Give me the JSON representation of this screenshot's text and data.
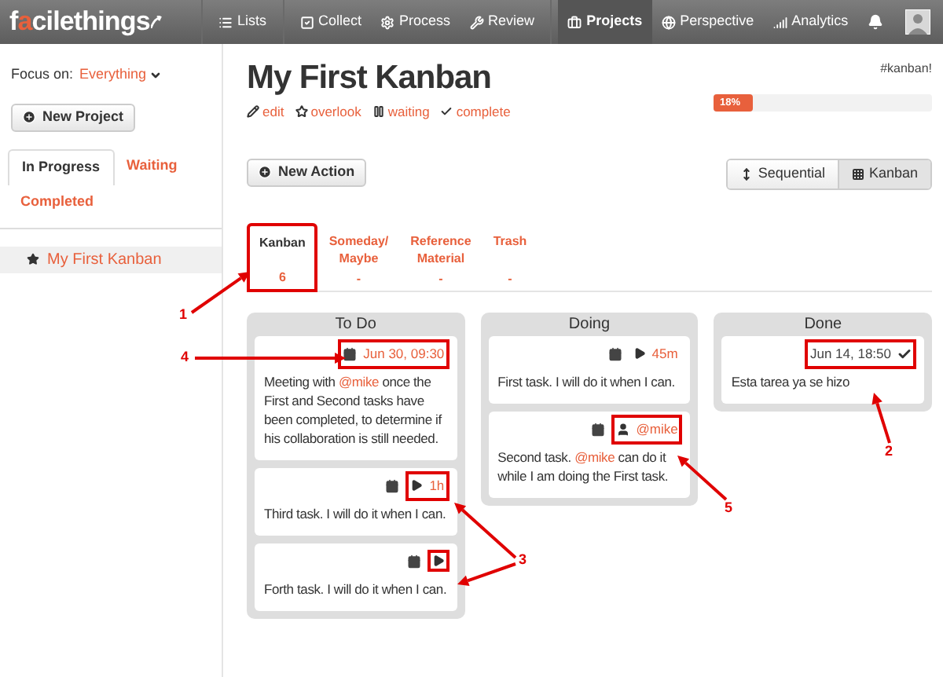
{
  "logo": {
    "parts": [
      {
        "text": "f",
        "accent": false
      },
      {
        "text": "a",
        "accent": true
      },
      {
        "text": "cilethings",
        "accent": false
      }
    ]
  },
  "nav": [
    [
      {
        "label": "Lists",
        "selected": false
      }
    ],
    [
      {
        "label": "Collect",
        "selected": false
      },
      {
        "label": "Process",
        "selected": false
      },
      {
        "label": "Review",
        "selected": false
      }
    ],
    [
      {
        "label": "Projects",
        "selected": true
      },
      {
        "label": "Perspective",
        "selected": false
      },
      {
        "label": "Analytics",
        "selected": false
      }
    ]
  ],
  "sidebar": {
    "focus_label": "Focus on:",
    "focus_value": "Everything",
    "new_project": "New Project",
    "tabs": [
      {
        "label": "In Progress",
        "selected": true
      },
      {
        "label": "Waiting",
        "selected": false
      },
      {
        "label": "Completed",
        "selected": false
      }
    ],
    "projects": [
      {
        "name": "My First Kanban",
        "selected": true
      }
    ]
  },
  "project": {
    "title": "My First Kanban",
    "tag": "#kanban!",
    "links": [
      {
        "kind": "edit",
        "label": "edit"
      },
      {
        "kind": "overlook",
        "label": "overlook"
      },
      {
        "kind": "waiting",
        "label": "waiting"
      },
      {
        "kind": "complete",
        "label": "complete"
      }
    ],
    "progress": {
      "level": 0.18,
      "reading": "18%"
    }
  },
  "new_action": "New Action",
  "views": [
    {
      "kind": "sequential",
      "label": "Sequential",
      "selected": false
    },
    {
      "kind": "kanban",
      "label": "Kanban",
      "selected": true
    }
  ],
  "list_tabs": [
    {
      "label": "Kanban",
      "count": "6",
      "selected": true,
      "highlighted": true
    },
    {
      "label": "Someday/\nMaybe",
      "count": "-",
      "selected": false,
      "highlighted": false
    },
    {
      "label": "Reference\nMaterial",
      "count": "-",
      "selected": false,
      "highlighted": false
    },
    {
      "label": "Trash",
      "count": "-",
      "selected": false,
      "highlighted": false
    }
  ],
  "columns": [
    {
      "title": "To Do",
      "cards": [
        {
          "meta": [
            {
              "kind": "date",
              "text": "Jun 30, 09:30",
              "highlighted": true
            }
          ],
          "text": [
            {
              "kind": "plain",
              "text": "Meeting with "
            },
            {
              "kind": "mention",
              "text": "@mike"
            },
            {
              "kind": "plain",
              "text": " once the First and Second tasks have been completed, to determine if his collaboration is still needed."
            }
          ]
        },
        {
          "meta": [
            {
              "kind": "calendar"
            },
            {
              "kind": "duration",
              "text": "1h",
              "highlighted": true
            }
          ],
          "text": [
            {
              "kind": "plain",
              "text": "Third task. I will do it when I can."
            }
          ]
        },
        {
          "meta": [
            {
              "kind": "calendar"
            },
            {
              "kind": "duration",
              "highlighted": true
            }
          ],
          "text": [
            {
              "kind": "plain",
              "text": "Forth task. I will do it when I can."
            }
          ]
        }
      ]
    },
    {
      "title": "Doing",
      "cards": [
        {
          "meta": [
            {
              "kind": "calendar"
            },
            {
              "kind": "duration",
              "text": "45m"
            }
          ],
          "text": [
            {
              "kind": "plain",
              "text": "First task. I will do it when I can."
            }
          ]
        },
        {
          "meta": [
            {
              "kind": "calendar"
            },
            {
              "kind": "person",
              "text": "@mike",
              "highlighted": true
            }
          ],
          "text": [
            {
              "kind": "plain",
              "text": "Second task. "
            },
            {
              "kind": "mention",
              "text": "@mike"
            },
            {
              "kind": "plain",
              "text": " can do it while I am doing the First task."
            }
          ]
        }
      ]
    },
    {
      "title": "Done",
      "cards": [
        {
          "meta": [
            {
              "kind": "done",
              "text": "Jun 14, 18:50",
              "highlighted": true
            }
          ],
          "text": [
            {
              "kind": "plain",
              "text": "Esta tarea ya se hizo"
            }
          ]
        }
      ]
    }
  ],
  "annotations": [
    {
      "number": "1"
    },
    {
      "number": "4"
    },
    {
      "number": "3"
    },
    {
      "number": "2"
    },
    {
      "number": "5"
    }
  ]
}
